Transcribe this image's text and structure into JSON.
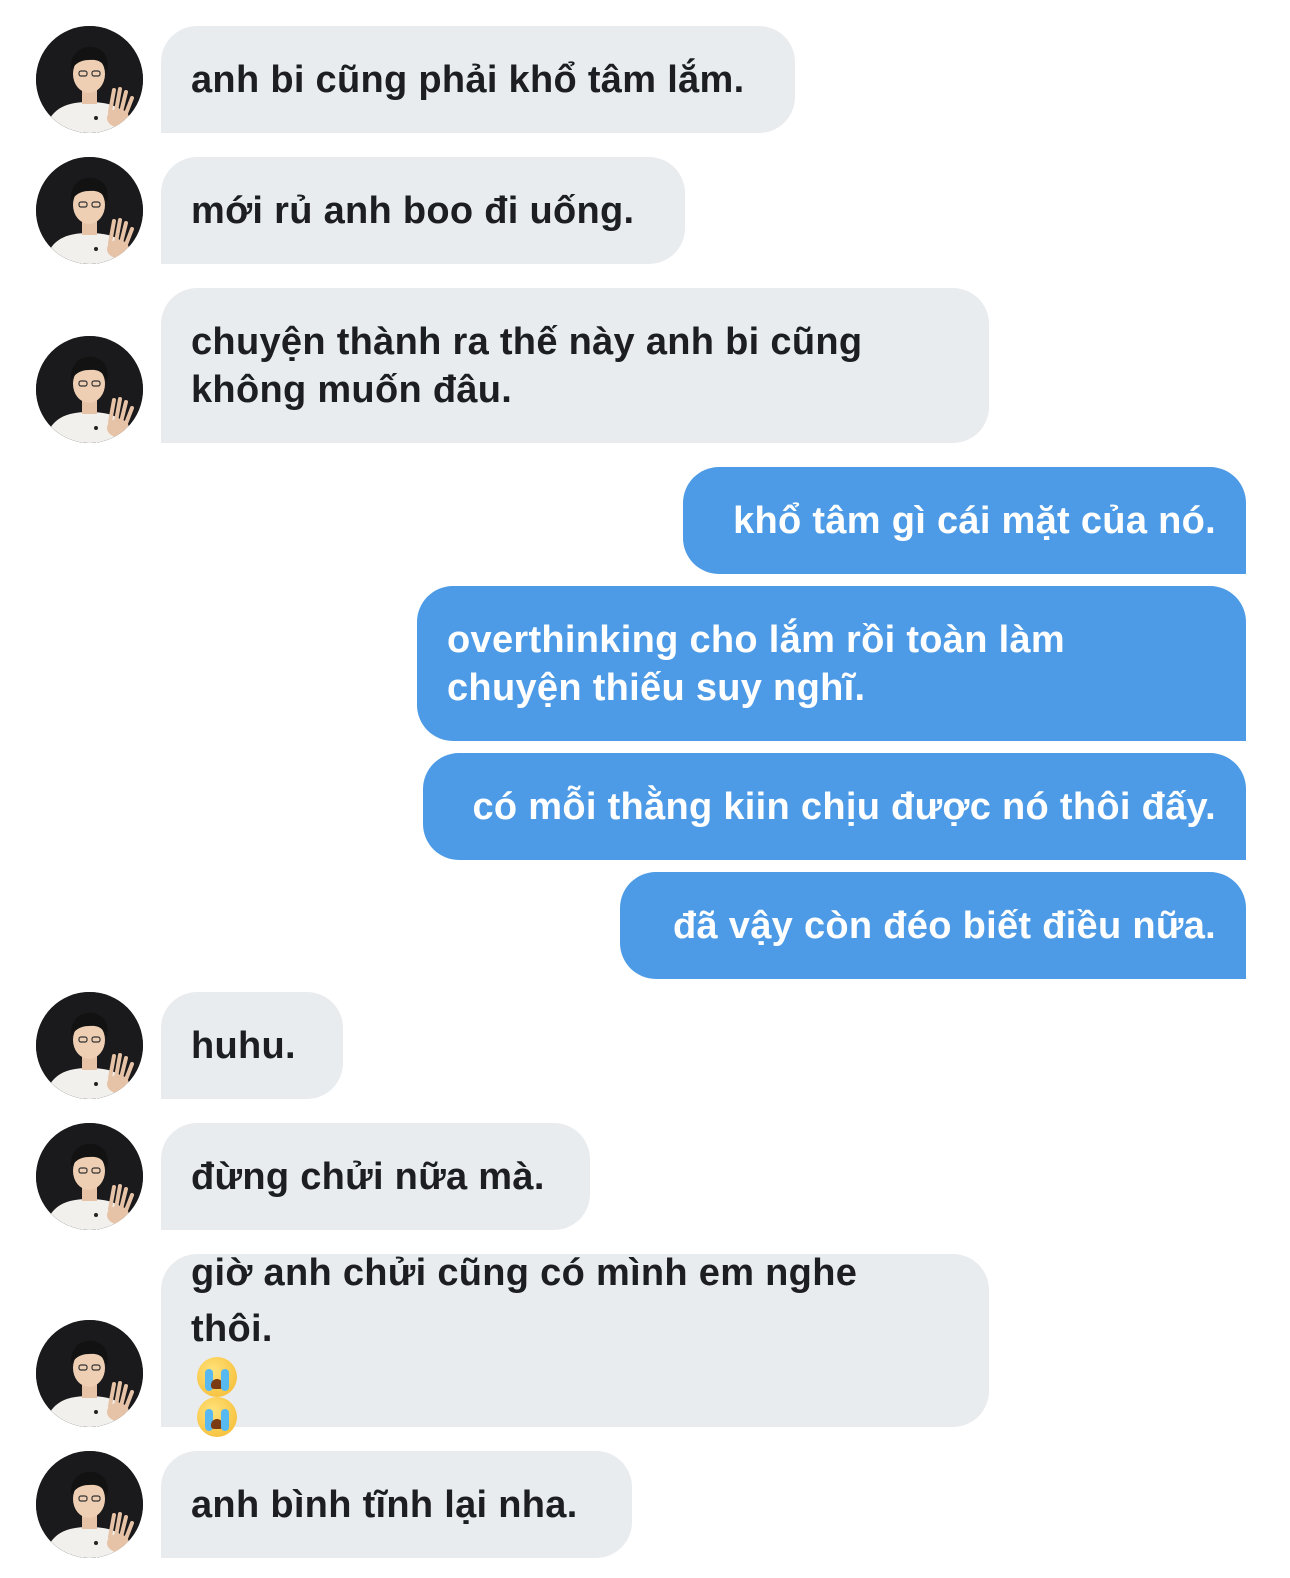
{
  "colors": {
    "incoming_bubble": "#e9ecef",
    "outgoing_bubble": "#4d9be6",
    "incoming_text": "#1c1e21",
    "outgoing_text": "#ffffff"
  },
  "contact": {
    "avatar_icon": "profile-photo-icon"
  },
  "messages": [
    {
      "sender": "contact",
      "text": "anh bi cũng phải khổ tâm lắm."
    },
    {
      "sender": "contact",
      "text": "mới rủ anh boo đi uống."
    },
    {
      "sender": "contact",
      "text": "chuyện thành ra thế này anh bi cũng\nkhông muốn đâu."
    },
    {
      "sender": "me",
      "text": "khổ tâm gì cái mặt của nó."
    },
    {
      "sender": "me",
      "text": "overthinking cho lắm rồi toàn làm\nchuyện thiếu suy nghĩ."
    },
    {
      "sender": "me",
      "text": "có mỗi thằng kiin chịu được nó thôi đấy."
    },
    {
      "sender": "me",
      "text": "đã vậy còn đéo biết điều nữa."
    },
    {
      "sender": "contact",
      "text": "huhu."
    },
    {
      "sender": "contact",
      "text": "đừng chửi nữa mà."
    },
    {
      "sender": "contact",
      "text": "giờ anh chửi cũng có mình em nghe\nthôi.",
      "emojis": [
        "crying-face-icon",
        "crying-face-icon"
      ]
    },
    {
      "sender": "contact",
      "text": "anh bình tĩnh lại nha."
    }
  ]
}
